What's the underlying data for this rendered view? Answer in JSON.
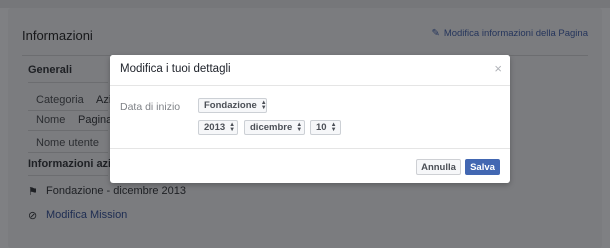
{
  "background": {
    "title": "Informazioni",
    "edit_link": "Modifica informazioni della Pagina",
    "section_general": "Generali",
    "rows": [
      {
        "label": "Categoria",
        "value": "Azi"
      },
      {
        "label": "Nome",
        "value": "Pagina"
      },
      {
        "label": "Nome utente",
        "value": ""
      }
    ],
    "section_company": "Informazioni azie",
    "founded_item": "Fondazione - dicembre 2013",
    "mission_link": "Modifica Mission",
    "flag_icon": "flag-icon",
    "mission_icon": "circle-slash-icon"
  },
  "modal": {
    "title": "Modifica i tuoi dettagli",
    "close_glyph": "×",
    "field_label": "Data di inizio",
    "type_select": "Fondazione",
    "year_select": "2013",
    "month_select": "dicembre",
    "day_select": "10",
    "cancel_label": "Annulla",
    "save_label": "Salva"
  },
  "colors": {
    "primary_button": "#4267b2",
    "overlay": "#7f8083"
  }
}
